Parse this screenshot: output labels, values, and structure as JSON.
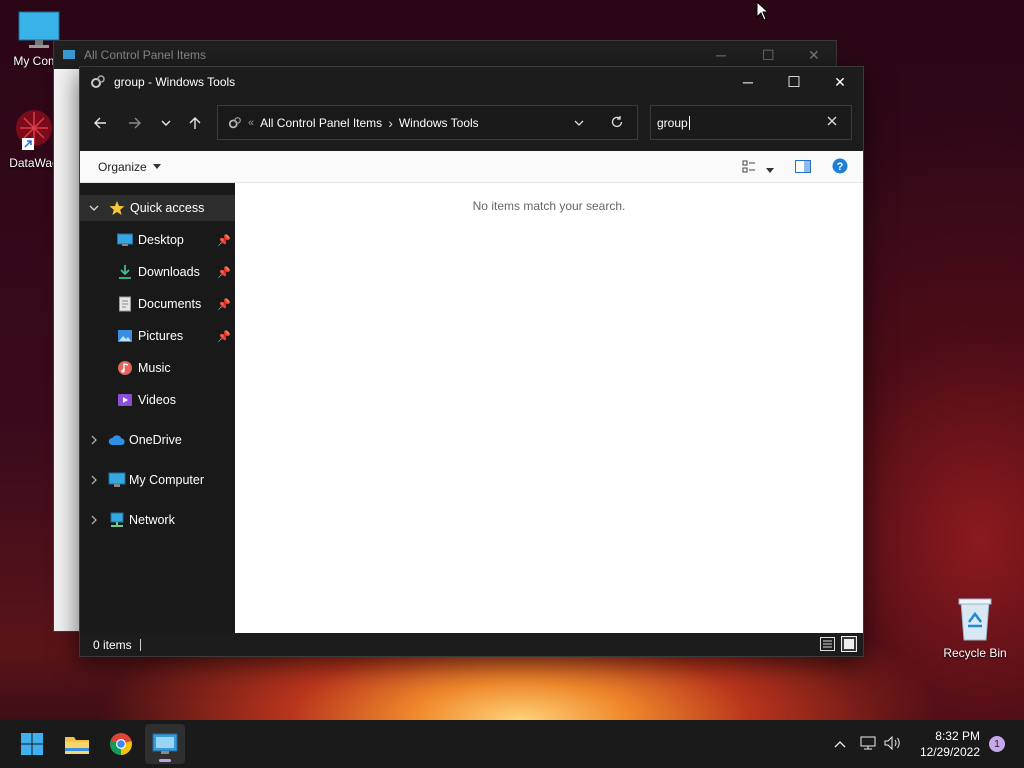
{
  "desktop": {
    "icons": [
      {
        "label": "My Comp"
      },
      {
        "label": "DataWag"
      },
      {
        "label": "Recycle Bin"
      }
    ]
  },
  "background_window": {
    "title": "All Control Panel Items"
  },
  "explorer": {
    "title": "group - Windows Tools",
    "breadcrumb": {
      "overflow": "«",
      "items": [
        "All Control Panel Items",
        "Windows Tools"
      ],
      "separator": "›"
    },
    "search": {
      "value": "group"
    },
    "command_bar": {
      "organize_label": "Organize"
    },
    "nav_pane": {
      "quick_access": "Quick access",
      "pinned": [
        {
          "label": "Desktop",
          "icon": "desktop-icon"
        },
        {
          "label": "Downloads",
          "icon": "download-icon"
        },
        {
          "label": "Documents",
          "icon": "document-icon"
        },
        {
          "label": "Pictures",
          "icon": "pictures-icon"
        },
        {
          "label": "Music",
          "icon": "music-icon"
        },
        {
          "label": "Videos",
          "icon": "videos-icon"
        }
      ],
      "onedrive": "OneDrive",
      "my_computer": "My Computer",
      "network": "Network"
    },
    "content": {
      "empty_message": "No items match your search."
    },
    "status": {
      "item_count": "0 items"
    }
  },
  "taskbar": {
    "apps": [
      "start-icon",
      "file-explorer-icon",
      "chrome-icon",
      "control-panel-icon"
    ],
    "clock": {
      "time": "8:32 PM",
      "date": "12/29/2022"
    },
    "notification_count": "1"
  },
  "colors": {
    "accent": "#0078d4",
    "folder": "#f4c14b",
    "star": "#f6c63b"
  }
}
